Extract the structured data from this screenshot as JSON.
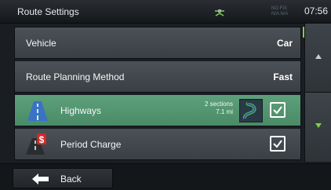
{
  "status": {
    "title": "Route Settings",
    "gps_info_line1": "NO FIX",
    "gps_info_line2": "N/A N/A",
    "clock": "07:56"
  },
  "rows": [
    {
      "label": "Vehicle",
      "value": "Car"
    },
    {
      "label": "Route Planning Method",
      "value": "Fast"
    },
    {
      "label": "Highways",
      "sections": "2 sections",
      "distance": "7.1 mi",
      "checked": true,
      "icon": "highway-icon"
    },
    {
      "label": "Period Charge",
      "checked": true,
      "icon": "toll-charge-icon"
    }
  ],
  "bottom": {
    "back_label": "Back"
  },
  "colors": {
    "row_dark": "#4b5157",
    "row_green": "#5ea07b",
    "accent_green": "#7dd14a",
    "background": "#1a1e22"
  }
}
